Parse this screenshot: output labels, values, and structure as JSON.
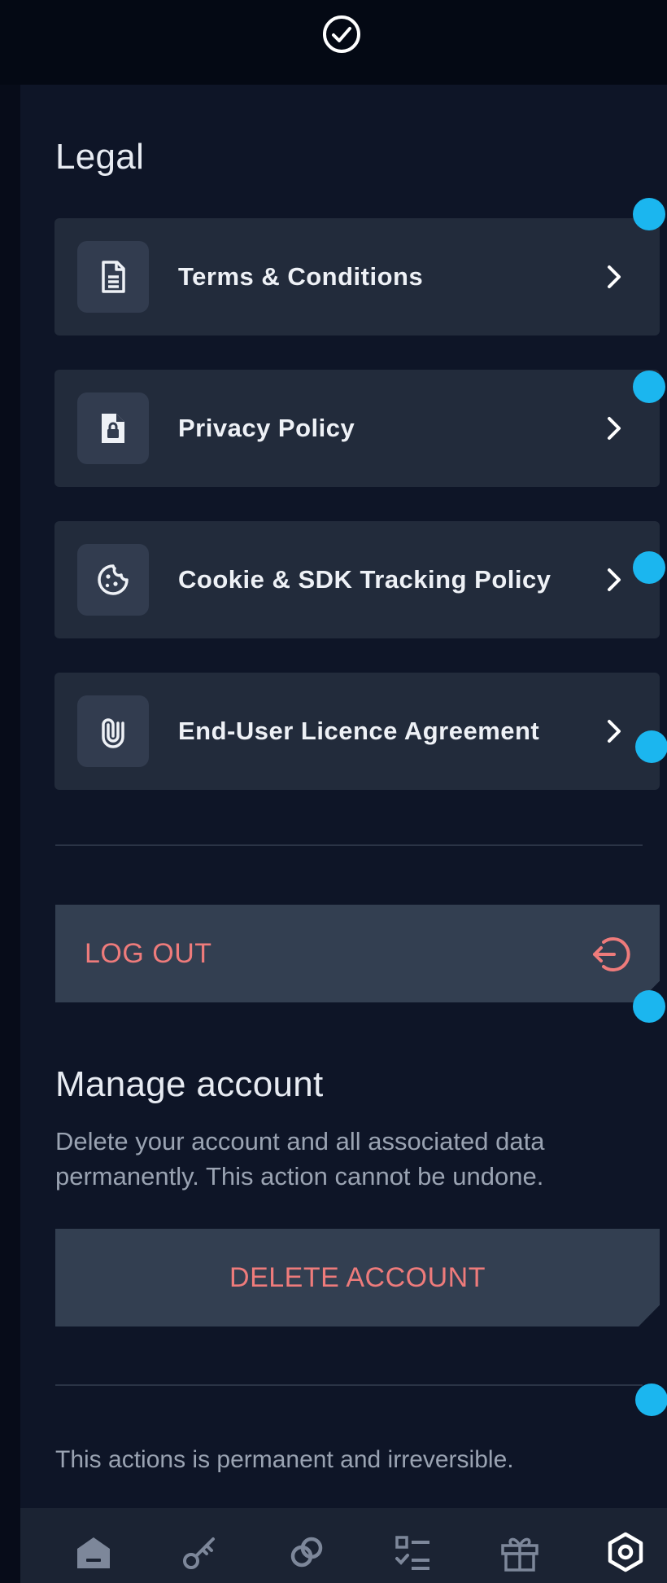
{
  "status": {
    "icon": "check-circle-icon"
  },
  "legal": {
    "title": "Legal",
    "items": [
      {
        "label": "Terms & Conditions",
        "icon": "document-icon"
      },
      {
        "label": "Privacy Policy",
        "icon": "lock-document-icon"
      },
      {
        "label": "Cookie & SDK Tracking Policy",
        "icon": "cookie-icon"
      },
      {
        "label": "End-User Licence Agreement",
        "icon": "paperclip-icon"
      }
    ]
  },
  "logout": {
    "label": "LOG OUT",
    "icon": "logout-icon"
  },
  "manage": {
    "title": "Manage account",
    "description": "Delete your account and all associated data permanently. This action cannot be undone.",
    "delete_label": "DELETE ACCOUNT"
  },
  "footer_note": "This actions is permanent and irreversible.",
  "nav": [
    {
      "icon": "home-icon"
    },
    {
      "icon": "key-icon"
    },
    {
      "icon": "link-icon"
    },
    {
      "icon": "checklist-icon"
    },
    {
      "icon": "gift-icon"
    },
    {
      "icon": "settings-icon",
      "active": true
    }
  ],
  "colors": {
    "accent_dot": "#1bb6ef",
    "danger": "#ee7b7b",
    "card": "#222b3b",
    "panel": "#0e1527"
  }
}
